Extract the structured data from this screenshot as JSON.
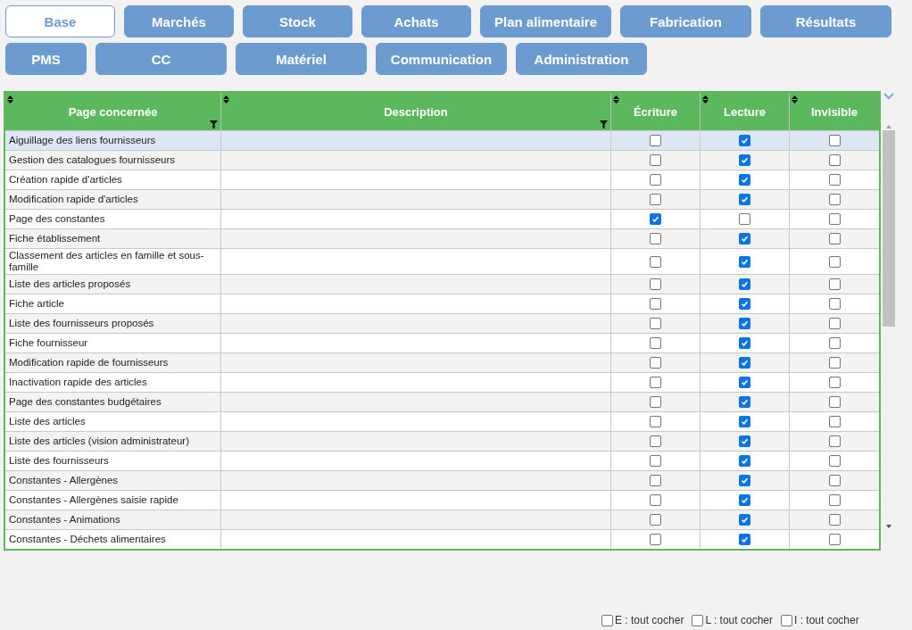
{
  "tabs": [
    {
      "label": "Base",
      "selected": true
    },
    {
      "label": "Marchés",
      "selected": false
    },
    {
      "label": "Stock",
      "selected": false
    },
    {
      "label": "Achats",
      "selected": false
    },
    {
      "label": "Plan alimentaire",
      "selected": false
    },
    {
      "label": "Fabrication",
      "selected": false
    },
    {
      "label": "Résultats",
      "selected": false
    },
    {
      "label": "PMS",
      "selected": false
    },
    {
      "label": "CC",
      "selected": false
    },
    {
      "label": "Matériel",
      "selected": false
    },
    {
      "label": "Communication",
      "selected": false
    },
    {
      "label": "Administration",
      "selected": false
    }
  ],
  "table": {
    "columns": [
      {
        "label": "Page concernée",
        "filterable": true
      },
      {
        "label": "Description",
        "filterable": true
      },
      {
        "label": "Écriture",
        "filterable": false
      },
      {
        "label": "Lecture",
        "filterable": false
      },
      {
        "label": "Invisible",
        "filterable": false
      }
    ],
    "rows": [
      {
        "page": "Aiguillage des liens fournisseurs",
        "selected": true,
        "write": false,
        "read": true,
        "invisible": false
      },
      {
        "page": "Gestion des catalogues fournisseurs",
        "selected": false,
        "write": false,
        "read": true,
        "invisible": false
      },
      {
        "page": "Création rapide d'articles",
        "selected": false,
        "write": false,
        "read": true,
        "invisible": false
      },
      {
        "page": "Modification rapide d'articles",
        "selected": false,
        "write": false,
        "read": true,
        "invisible": false
      },
      {
        "page": "Page des constantes",
        "selected": false,
        "write": true,
        "read": false,
        "invisible": false
      },
      {
        "page": "Fiche établissement",
        "selected": false,
        "write": false,
        "read": true,
        "invisible": false
      },
      {
        "page": "Classement des articles en famille et sous-famille",
        "selected": false,
        "write": false,
        "read": true,
        "invisible": false
      },
      {
        "page": "Liste des articles proposés",
        "selected": false,
        "write": false,
        "read": true,
        "invisible": false
      },
      {
        "page": "Fiche article",
        "selected": false,
        "write": false,
        "read": true,
        "invisible": false
      },
      {
        "page": "Liste des fournisseurs proposés",
        "selected": false,
        "write": false,
        "read": true,
        "invisible": false
      },
      {
        "page": "Fiche fournisseur",
        "selected": false,
        "write": false,
        "read": true,
        "invisible": false
      },
      {
        "page": "Modification rapide de fournisseurs",
        "selected": false,
        "write": false,
        "read": true,
        "invisible": false
      },
      {
        "page": "Inactivation rapide des articles",
        "selected": false,
        "write": false,
        "read": true,
        "invisible": false
      },
      {
        "page": "Page des constantes budgétaires",
        "selected": false,
        "write": false,
        "read": true,
        "invisible": false
      },
      {
        "page": "Liste des articles",
        "selected": false,
        "write": false,
        "read": true,
        "invisible": false
      },
      {
        "page": "Liste des articles (vision administrateur)",
        "selected": false,
        "write": false,
        "read": true,
        "invisible": false
      },
      {
        "page": "Liste des fournisseurs",
        "selected": false,
        "write": false,
        "read": true,
        "invisible": false
      },
      {
        "page": "Constantes - Allergènes",
        "selected": false,
        "write": false,
        "read": true,
        "invisible": false
      },
      {
        "page": "Constantes - Allergènes saisie rapide",
        "selected": false,
        "write": false,
        "read": true,
        "invisible": false
      },
      {
        "page": "Constantes - Animations",
        "selected": false,
        "write": false,
        "read": true,
        "invisible": false
      },
      {
        "page": "Constantes - Déchets alimentaires",
        "selected": false,
        "write": false,
        "read": true,
        "invisible": false
      }
    ]
  },
  "check_all": [
    {
      "label": "E : tout cocher",
      "checked": false
    },
    {
      "label": "L : tout cocher",
      "checked": false
    },
    {
      "label": "I : tout cocher",
      "checked": false
    }
  ]
}
